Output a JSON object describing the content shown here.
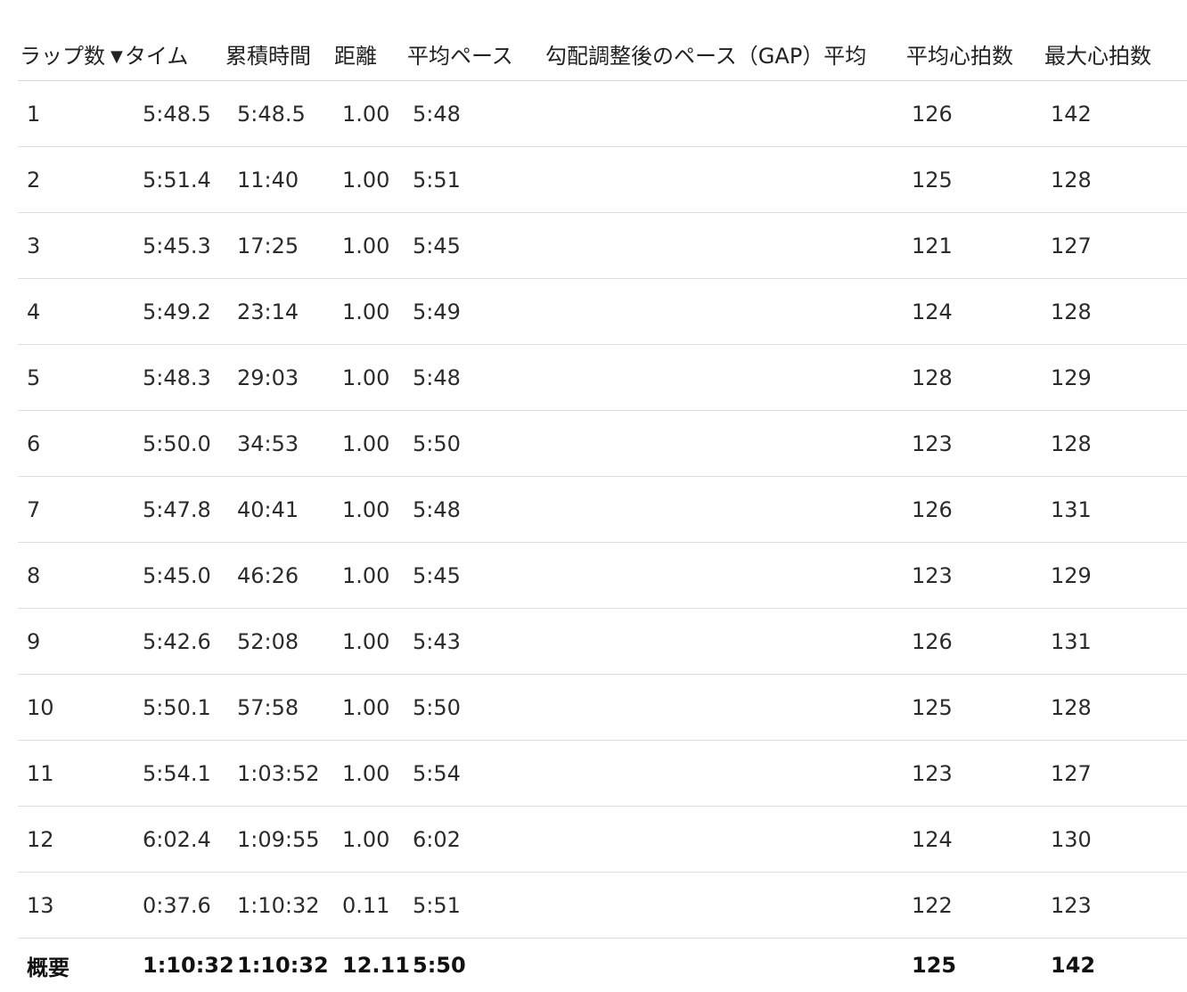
{
  "columns": {
    "lap": "ラップ数",
    "time": "タイム",
    "cumulative": "累積時間",
    "distance": "距離",
    "avg_pace": "平均ペース",
    "gap_pace": "勾配調整後のペース（GAP）平均",
    "avg_hr": "平均心拍数",
    "max_hr": "最大心拍数"
  },
  "sort": {
    "column": "time",
    "direction": "descending",
    "icon": "sort-desc-icon"
  },
  "rows": [
    {
      "lap": "1",
      "time": "5:48.5",
      "cumulative": "5:48.5",
      "distance": "1.00",
      "avg_pace": "5:48",
      "gap_pace": "",
      "avg_hr": "126",
      "max_hr": "142"
    },
    {
      "lap": "2",
      "time": "5:51.4",
      "cumulative": "11:40",
      "distance": "1.00",
      "avg_pace": "5:51",
      "gap_pace": "",
      "avg_hr": "125",
      "max_hr": "128"
    },
    {
      "lap": "3",
      "time": "5:45.3",
      "cumulative": "17:25",
      "distance": "1.00",
      "avg_pace": "5:45",
      "gap_pace": "",
      "avg_hr": "121",
      "max_hr": "127"
    },
    {
      "lap": "4",
      "time": "5:49.2",
      "cumulative": "23:14",
      "distance": "1.00",
      "avg_pace": "5:49",
      "gap_pace": "",
      "avg_hr": "124",
      "max_hr": "128"
    },
    {
      "lap": "5",
      "time": "5:48.3",
      "cumulative": "29:03",
      "distance": "1.00",
      "avg_pace": "5:48",
      "gap_pace": "",
      "avg_hr": "128",
      "max_hr": "129"
    },
    {
      "lap": "6",
      "time": "5:50.0",
      "cumulative": "34:53",
      "distance": "1.00",
      "avg_pace": "5:50",
      "gap_pace": "",
      "avg_hr": "123",
      "max_hr": "128"
    },
    {
      "lap": "7",
      "time": "5:47.8",
      "cumulative": "40:41",
      "distance": "1.00",
      "avg_pace": "5:48",
      "gap_pace": "",
      "avg_hr": "126",
      "max_hr": "131"
    },
    {
      "lap": "8",
      "time": "5:45.0",
      "cumulative": "46:26",
      "distance": "1.00",
      "avg_pace": "5:45",
      "gap_pace": "",
      "avg_hr": "123",
      "max_hr": "129"
    },
    {
      "lap": "9",
      "time": "5:42.6",
      "cumulative": "52:08",
      "distance": "1.00",
      "avg_pace": "5:43",
      "gap_pace": "",
      "avg_hr": "126",
      "max_hr": "131"
    },
    {
      "lap": "10",
      "time": "5:50.1",
      "cumulative": "57:58",
      "distance": "1.00",
      "avg_pace": "5:50",
      "gap_pace": "",
      "avg_hr": "125",
      "max_hr": "128"
    },
    {
      "lap": "11",
      "time": "5:54.1",
      "cumulative": "1:03:52",
      "distance": "1.00",
      "avg_pace": "5:54",
      "gap_pace": "",
      "avg_hr": "123",
      "max_hr": "127"
    },
    {
      "lap": "12",
      "time": "6:02.4",
      "cumulative": "1:09:55",
      "distance": "1.00",
      "avg_pace": "6:02",
      "gap_pace": "",
      "avg_hr": "124",
      "max_hr": "130"
    },
    {
      "lap": "13",
      "time": "0:37.6",
      "cumulative": "1:10:32",
      "distance": "0.11",
      "avg_pace": "5:51",
      "gap_pace": "",
      "avg_hr": "122",
      "max_hr": "123"
    }
  ],
  "summary": {
    "lap": "概要",
    "time": "1:10:32",
    "cumulative": "1:10:32",
    "distance": "12.11",
    "avg_pace": "5:50",
    "gap_pace": "",
    "avg_hr": "125",
    "max_hr": "142"
  }
}
